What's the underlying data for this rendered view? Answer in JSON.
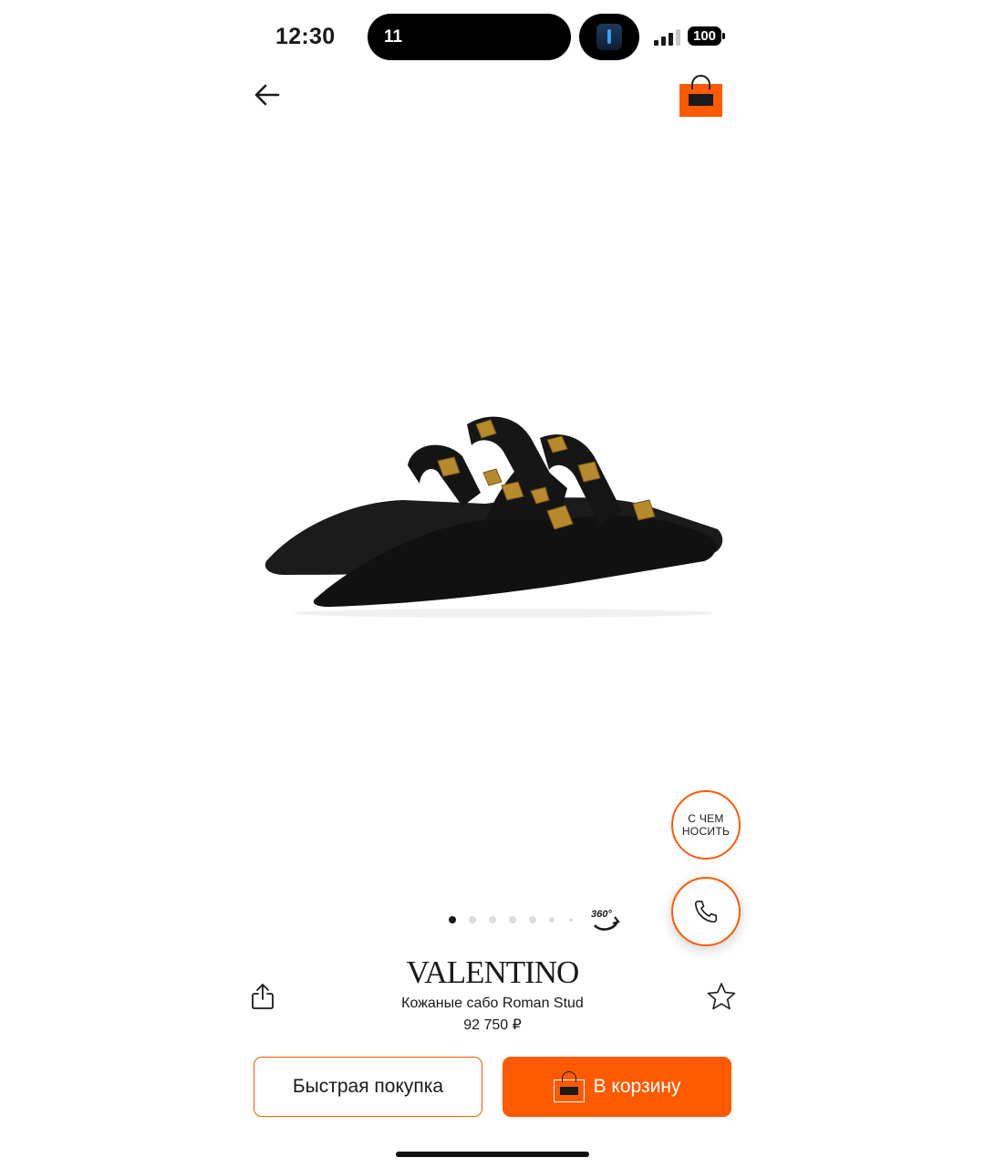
{
  "status_bar": {
    "time": "12:30",
    "activity_text": "11",
    "battery": "100"
  },
  "nav": {
    "back_icon": "arrow-left-icon",
    "cart_icon": "shopping-bag-icon"
  },
  "gallery": {
    "image_count": 7,
    "active_index": 0,
    "view_360_label": "360°"
  },
  "floating": {
    "outfit_label": "С ЧЕМ\nНОСИТЬ",
    "call_icon": "phone-icon"
  },
  "product": {
    "brand": "VALENTINO",
    "name": "Кожаные сабо Roman Stud",
    "price": "92 750 ₽"
  },
  "actions": {
    "quick_buy": "Быстрая покупка",
    "add_to_cart": "В корзину"
  },
  "colors": {
    "accent": "#ff5a00",
    "text": "#1a1a1a"
  }
}
